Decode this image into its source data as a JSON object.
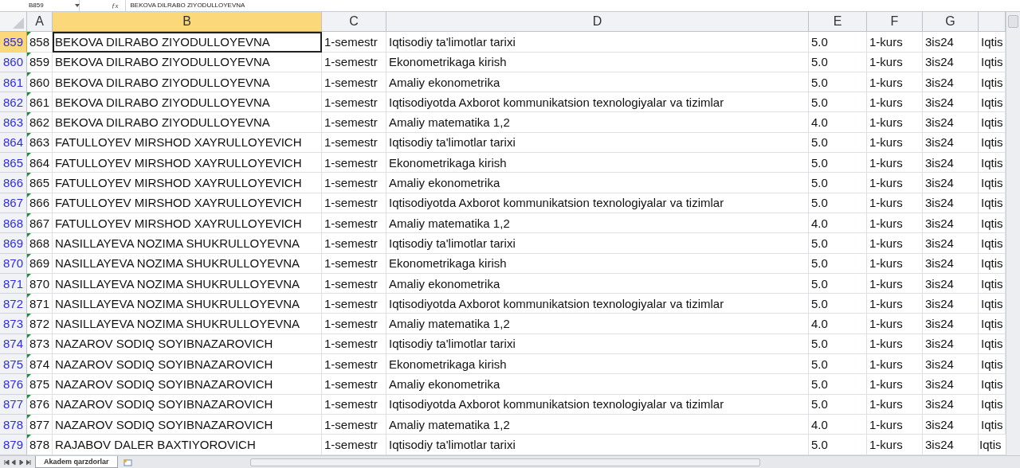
{
  "formula_bar": {
    "name_box": "B859",
    "function_label": "ƒx",
    "formula": "BEKOVA DILRABO ZIYODULLOYEVNA"
  },
  "columns": [
    {
      "label": "A",
      "selected": false
    },
    {
      "label": "B",
      "selected": true
    },
    {
      "label": "C",
      "selected": false
    },
    {
      "label": "D",
      "selected": false
    },
    {
      "label": "E",
      "selected": false
    },
    {
      "label": "F",
      "selected": false
    },
    {
      "label": "G",
      "selected": false
    }
  ],
  "rows": [
    {
      "header": "859",
      "selected": true,
      "cells": [
        "858",
        "BEKOVA DILRABO ZIYODULLOYEVNA",
        "1-semestr",
        "Iqtisodiy ta'limotlar tarixi",
        "5.0",
        "1-kurs",
        "3is24",
        "Iqtis"
      ]
    },
    {
      "header": "860",
      "selected": false,
      "cells": [
        "859",
        "BEKOVA DILRABO ZIYODULLOYEVNA",
        "1-semestr",
        "Ekonometrikaga kirish",
        "5.0",
        "1-kurs",
        "3is24",
        "Iqtis"
      ]
    },
    {
      "header": "861",
      "selected": false,
      "cells": [
        "860",
        "BEKOVA DILRABO ZIYODULLOYEVNA",
        "1-semestr",
        "Amaliy ekonometrika",
        "5.0",
        "1-kurs",
        "3is24",
        "Iqtis"
      ]
    },
    {
      "header": "862",
      "selected": false,
      "cells": [
        "861",
        "BEKOVA DILRABO ZIYODULLOYEVNA",
        "1-semestr",
        "Iqtisodiyotda Axborot kommunikatsion texnologiyalar va tizimlar",
        "5.0",
        "1-kurs",
        "3is24",
        "Iqtis"
      ]
    },
    {
      "header": "863",
      "selected": false,
      "cells": [
        "862",
        "BEKOVA DILRABO ZIYODULLOYEVNA",
        "1-semestr",
        "Amaliy matematika 1,2",
        "4.0",
        "1-kurs",
        "3is24",
        "Iqtis"
      ]
    },
    {
      "header": "864",
      "selected": false,
      "cells": [
        "863",
        "FATULLOYEV MIRSHOD XAYRULLOYEVICH",
        "1-semestr",
        "Iqtisodiy ta'limotlar tarixi",
        "5.0",
        "1-kurs",
        "3is24",
        "Iqtis"
      ]
    },
    {
      "header": "865",
      "selected": false,
      "cells": [
        "864",
        "FATULLOYEV MIRSHOD XAYRULLOYEVICH",
        "1-semestr",
        "Ekonometrikaga kirish",
        "5.0",
        "1-kurs",
        "3is24",
        "Iqtis"
      ]
    },
    {
      "header": "866",
      "selected": false,
      "cells": [
        "865",
        "FATULLOYEV MIRSHOD XAYRULLOYEVICH",
        "1-semestr",
        "Amaliy ekonometrika",
        "5.0",
        "1-kurs",
        "3is24",
        "Iqtis"
      ]
    },
    {
      "header": "867",
      "selected": false,
      "cells": [
        "866",
        "FATULLOYEV MIRSHOD XAYRULLOYEVICH",
        "1-semestr",
        "Iqtisodiyotda Axborot kommunikatsion texnologiyalar va tizimlar",
        "5.0",
        "1-kurs",
        "3is24",
        "Iqtis"
      ]
    },
    {
      "header": "868",
      "selected": false,
      "cells": [
        "867",
        "FATULLOYEV MIRSHOD XAYRULLOYEVICH",
        "1-semestr",
        "Amaliy matematika 1,2",
        "4.0",
        "1-kurs",
        "3is24",
        "Iqtis"
      ]
    },
    {
      "header": "869",
      "selected": false,
      "cells": [
        "868",
        "NASILLAYEVA NOZIMA SHUKRULLOYEVNA",
        "1-semestr",
        "Iqtisodiy ta'limotlar tarixi",
        "5.0",
        "1-kurs",
        "3is24",
        "Iqtis"
      ]
    },
    {
      "header": "870",
      "selected": false,
      "cells": [
        "869",
        "NASILLAYEVA NOZIMA SHUKRULLOYEVNA",
        "1-semestr",
        "Ekonometrikaga kirish",
        "5.0",
        "1-kurs",
        "3is24",
        "Iqtis"
      ]
    },
    {
      "header": "871",
      "selected": false,
      "cells": [
        "870",
        "NASILLAYEVA NOZIMA SHUKRULLOYEVNA",
        "1-semestr",
        "Amaliy ekonometrika",
        "5.0",
        "1-kurs",
        "3is24",
        "Iqtis"
      ]
    },
    {
      "header": "872",
      "selected": false,
      "cells": [
        "871",
        "NASILLAYEVA NOZIMA SHUKRULLOYEVNA",
        "1-semestr",
        "Iqtisodiyotda Axborot kommunikatsion texnologiyalar va tizimlar",
        "5.0",
        "1-kurs",
        "3is24",
        "Iqtis"
      ]
    },
    {
      "header": "873",
      "selected": false,
      "cells": [
        "872",
        "NASILLAYEVA NOZIMA SHUKRULLOYEVNA",
        "1-semestr",
        "Amaliy matematika 1,2",
        "4.0",
        "1-kurs",
        "3is24",
        "Iqtis"
      ]
    },
    {
      "header": "874",
      "selected": false,
      "cells": [
        "873",
        "NAZAROV SODIQ SOYIBNAZAROVICH",
        "1-semestr",
        "Iqtisodiy ta'limotlar tarixi",
        "5.0",
        "1-kurs",
        "3is24",
        "Iqtis"
      ]
    },
    {
      "header": "875",
      "selected": false,
      "cells": [
        "874",
        "NAZAROV SODIQ SOYIBNAZAROVICH",
        "1-semestr",
        "Ekonometrikaga kirish",
        "5.0",
        "1-kurs",
        "3is24",
        "Iqtis"
      ]
    },
    {
      "header": "876",
      "selected": false,
      "cells": [
        "875",
        "NAZAROV SODIQ SOYIBNAZAROVICH",
        "1-semestr",
        "Amaliy ekonometrika",
        "5.0",
        "1-kurs",
        "3is24",
        "Iqtis"
      ]
    },
    {
      "header": "877",
      "selected": false,
      "cells": [
        "876",
        "NAZAROV SODIQ SOYIBNAZAROVICH",
        "1-semestr",
        "Iqtisodiyotda Axborot kommunikatsion texnologiyalar va tizimlar",
        "5.0",
        "1-kurs",
        "3is24",
        "Iqtis"
      ]
    },
    {
      "header": "878",
      "selected": false,
      "cells": [
        "877",
        "NAZAROV SODIQ SOYIBNAZAROVICH",
        "1-semestr",
        "Amaliy matematika 1,2",
        "4.0",
        "1-kurs",
        "3is24",
        "Iqtis"
      ]
    },
    {
      "header": "879",
      "selected": false,
      "cells": [
        "878",
        "RAJABOV DALER BAXTIYOROVICH",
        "1-semestr",
        "Iqtisodiy ta'limotlar tarixi",
        "5.0",
        "1-kurs",
        "3is24",
        "Iqtis"
      ]
    }
  ],
  "sheet_tabs": [
    {
      "label": "Akadem qarzdorlar",
      "selected": true
    }
  ]
}
